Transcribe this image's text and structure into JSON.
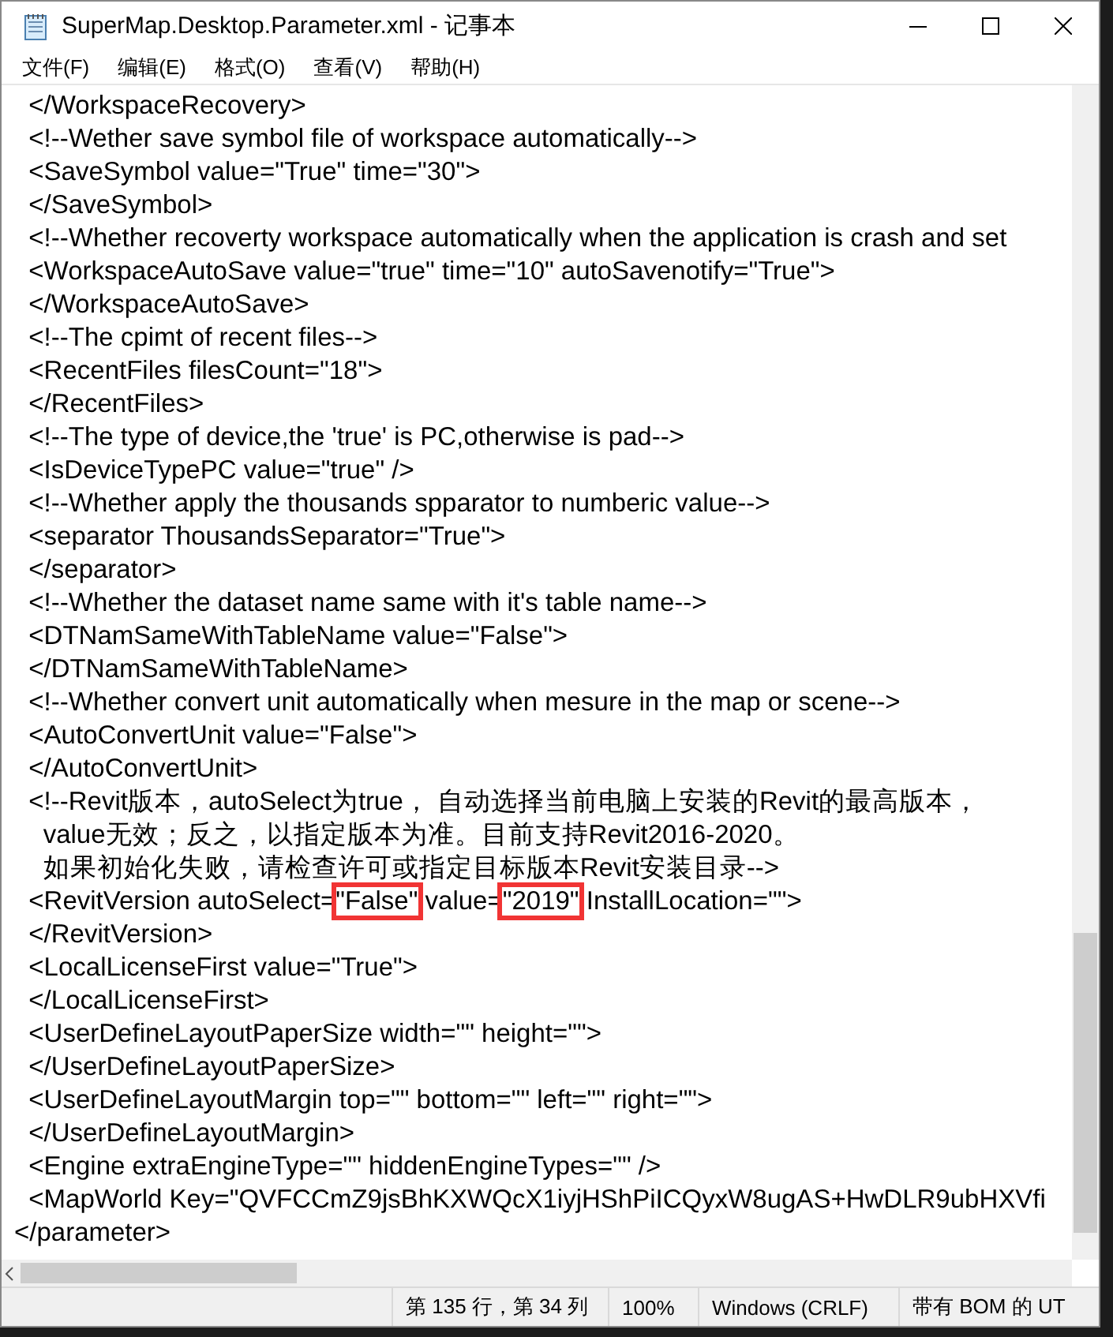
{
  "window": {
    "title": "SuperMap.Desktop.Parameter.xml - 记事本"
  },
  "menu": [
    {
      "label": "文件(F)"
    },
    {
      "label": "编辑(E)"
    },
    {
      "label": "格式(O)"
    },
    {
      "label": "查看(V)"
    },
    {
      "label": "帮助(H)"
    }
  ],
  "editor": {
    "lines": [
      {
        "text": "  </WorkspaceRecovery>"
      },
      {
        "text": "  <!--Wether save symbol file of workspace automatically-->"
      },
      {
        "text": "  <SaveSymbol value=\"True\" time=\"30\">"
      },
      {
        "text": "  </SaveSymbol>"
      },
      {
        "text": "  <!--Whether recoverty workspace automatically when the application is crash and set"
      },
      {
        "text": "  <WorkspaceAutoSave value=\"true\" time=\"10\" autoSavenotify=\"True\">"
      },
      {
        "text": "  </WorkspaceAutoSave>"
      },
      {
        "text": "  <!--The cpimt of recent files-->"
      },
      {
        "text": "  <RecentFiles filesCount=\"18\">"
      },
      {
        "text": "  </RecentFiles>"
      },
      {
        "text": "  <!--The type of device,the 'true' is PC,otherwise is pad-->"
      },
      {
        "text": "  <IsDeviceTypePC value=\"true\" />"
      },
      {
        "text": "  <!--Whether apply the thousands spparator to numberic value-->"
      },
      {
        "text": "  <separator ThousandsSeparator=\"True\">"
      },
      {
        "text": "  </separator>"
      },
      {
        "text": "  <!--Whether the dataset name same with it's table name-->"
      },
      {
        "text": "  <DTNamSameWithTableName value=\"False\">"
      },
      {
        "text": "  </DTNamSameWithTableName>"
      },
      {
        "text": "  <!--Whether convert unit automatically when mesure in the map or scene-->"
      },
      {
        "text": "  <AutoConvertUnit value=\"False\">"
      },
      {
        "text": "  </AutoConvertUnit>"
      },
      {
        "text": "  <!--Revit版本，autoSelect为true， 自动选择当前电脑上安装的Revit的最高版本，"
      },
      {
        "text": "    value无效；反之，以指定版本为准。目前支持Revit2016-2020。"
      },
      {
        "text": "    如果初始化失败，请检查许可或指定目标版本Revit安装目录-->"
      },
      {
        "segments": [
          {
            "text": "  <RevitVersion autoSelect=",
            "highlighted": false
          },
          {
            "text": "\"False\"",
            "highlighted": true
          },
          {
            "text": " value=",
            "highlighted": false
          },
          {
            "text": "\"2019\"",
            "highlighted": true
          },
          {
            "text": " InstallLocation=\"\">",
            "highlighted": false
          }
        ]
      },
      {
        "text": "  </RevitVersion>"
      },
      {
        "text": "  <LocalLicenseFirst value=\"True\">"
      },
      {
        "text": "  </LocalLicenseFirst>"
      },
      {
        "text": "  <UserDefineLayoutPaperSize width=\"\" height=\"\">"
      },
      {
        "text": "  </UserDefineLayoutPaperSize>"
      },
      {
        "text": "  <UserDefineLayoutMargin top=\"\" bottom=\"\" left=\"\" right=\"\">"
      },
      {
        "text": "  </UserDefineLayoutMargin>"
      },
      {
        "text": "  <Engine extraEngineType=\"\" hiddenEngineTypes=\"\" />"
      },
      {
        "text": "  <MapWorld Key=\"QVFCCmZ9jsBhKXWQcX1iyjHShPiICQyxW8ugAS+HwDLR9ubHXVfi"
      },
      {
        "text": "</parameter>"
      }
    ]
  },
  "status_bar": [
    {
      "text": "第 135 行，第 34 列"
    },
    {
      "text": "100%"
    },
    {
      "text": "Windows (CRLF)"
    },
    {
      "text": "带有 BOM 的 UT"
    }
  ]
}
